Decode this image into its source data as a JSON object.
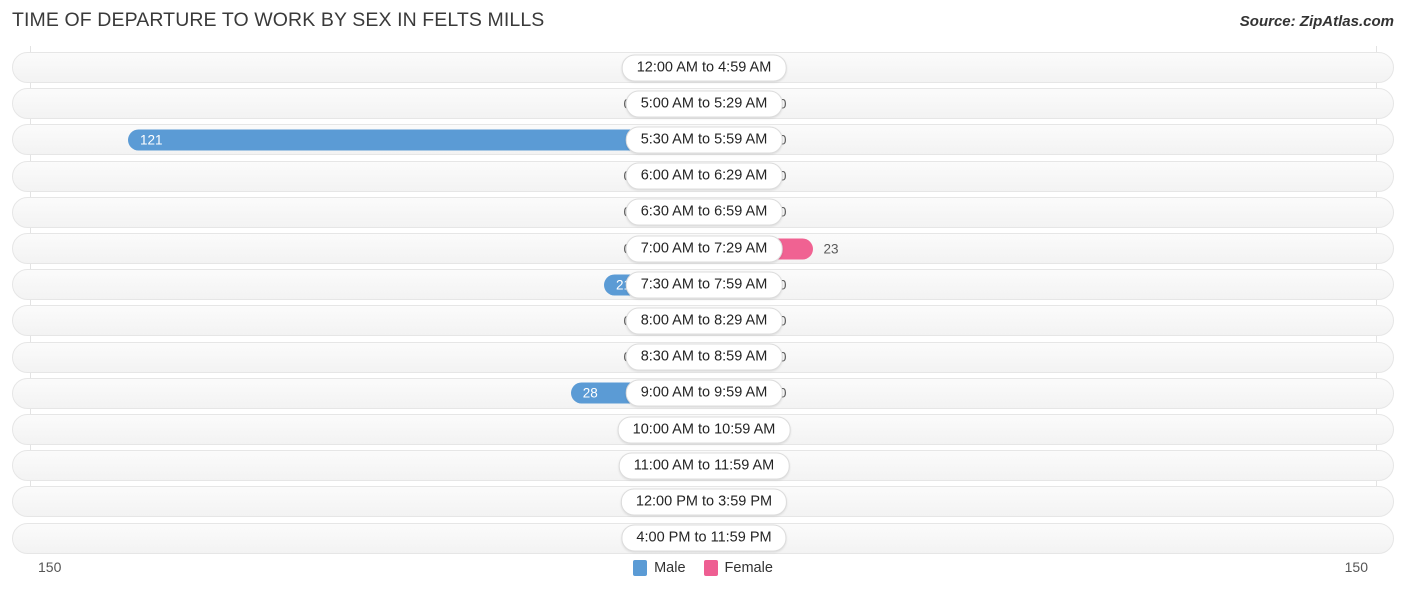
{
  "header": {
    "title": "TIME OF DEPARTURE TO WORK BY SEX IN FELTS MILLS",
    "source": "Source: ZipAtlas.com"
  },
  "legend": {
    "items": [
      {
        "label": "Male",
        "color": "#5b9bd5"
      },
      {
        "label": "Female",
        "color": "#ee5e92"
      }
    ]
  },
  "axis": {
    "left_max": "150",
    "right_max": "150"
  },
  "colors": {
    "male_strong": "#5b9bd5",
    "male_light": "#a8c7ea",
    "female_strong": "#f06292",
    "female_light": "#f9a7c0",
    "row_border": "#e6e6e6",
    "gridline": "#e3e3e3",
    "title_text": "#3a3a3a"
  },
  "chart_data": {
    "type": "bar",
    "subtype": "diverging-bar",
    "title": "TIME OF DEPARTURE TO WORK BY SEX IN FELTS MILLS",
    "xlabel": "",
    "ylabel": "",
    "xlim": [
      150,
      150
    ],
    "grid": false,
    "legend_position": "bottom-center",
    "categories": [
      "12:00 AM to 4:59 AM",
      "5:00 AM to 5:29 AM",
      "5:30 AM to 5:59 AM",
      "6:00 AM to 6:29 AM",
      "6:30 AM to 6:59 AM",
      "7:00 AM to 7:29 AM",
      "7:30 AM to 7:59 AM",
      "8:00 AM to 8:29 AM",
      "8:30 AM to 8:59 AM",
      "9:00 AM to 9:59 AM",
      "10:00 AM to 10:59 AM",
      "11:00 AM to 11:59 AM",
      "12:00 PM to 3:59 PM",
      "4:00 PM to 11:59 PM"
    ],
    "series": [
      {
        "name": "Male",
        "direction": "left",
        "values": [
          0,
          0,
          121,
          0,
          0,
          0,
          21,
          0,
          0,
          28,
          0,
          0,
          0,
          0
        ]
      },
      {
        "name": "Female",
        "direction": "right",
        "values": [
          0,
          0,
          0,
          0,
          0,
          23,
          0,
          0,
          0,
          0,
          0,
          0,
          0,
          0
        ]
      }
    ],
    "value_labels": {
      "male": [
        "0",
        "0",
        "121",
        "0",
        "0",
        "0",
        "21",
        "0",
        "0",
        "28",
        "0",
        "0",
        "0",
        "0"
      ],
      "female": [
        "0",
        "0",
        "0",
        "0",
        "0",
        "23",
        "0",
        "0",
        "0",
        "0",
        "0",
        "0",
        "0",
        "0"
      ]
    }
  }
}
